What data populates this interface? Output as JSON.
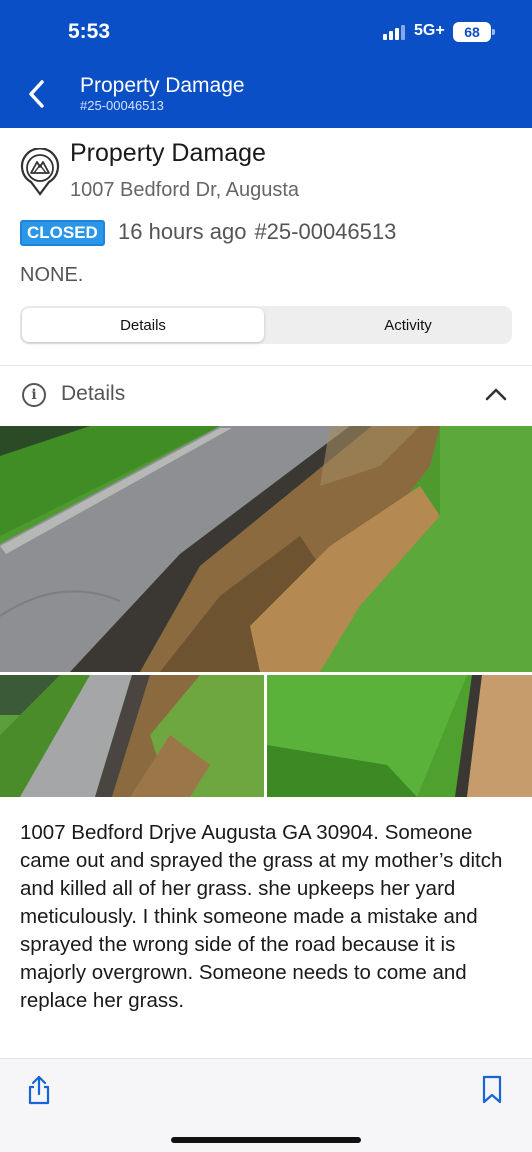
{
  "status": {
    "time": "5:53",
    "network": "5G+",
    "battery": "68"
  },
  "nav": {
    "title": "Property Damage",
    "subtitle": "#25-00046513"
  },
  "report": {
    "title": "Property Damage",
    "address": "1007 Bedford Dr, Augusta",
    "status_badge": "CLOSED",
    "time_ago": "16 hours ago",
    "ticket_id": "#25-00046513",
    "summary": "NONE."
  },
  "tabs": [
    {
      "label": "Details",
      "active": true
    },
    {
      "label": "Activity",
      "active": false
    }
  ],
  "details_section": {
    "label": "Details"
  },
  "description": "1007 Bedford Drjve Augusta GA 30904. Someone came out and sprayed the grass at my mother’s ditch and killed all of her grass. she upkeeps her yard meticulously.  I think someone made a mistake and sprayed the wrong side of the road because it is majorly overgrown.  Someone needs to come and replace her grass.",
  "colors": {
    "header": "#0a4fc6",
    "badge": "#2b95e8",
    "accent": "#1565d8"
  },
  "icons": [
    "back-chevron-icon",
    "map-pin-icon",
    "info-icon",
    "chevron-up-icon",
    "share-icon",
    "bookmark-icon"
  ]
}
